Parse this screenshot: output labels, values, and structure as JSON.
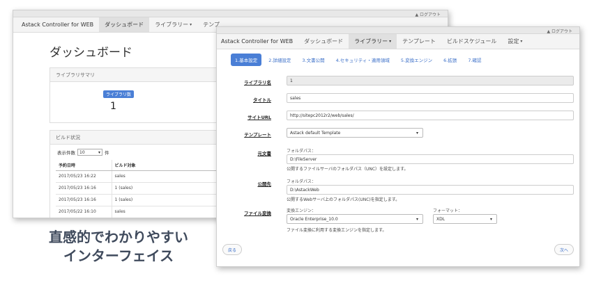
{
  "back_window": {
    "user": "▲ ログアウト",
    "nav": {
      "brand": "Astack Controller for WEB",
      "dashboard": "ダッシュボード",
      "library": "ライブラリー",
      "template": "テンプ"
    },
    "page_title": "ダッシュボード",
    "summary": {
      "header": "ライブラリサマリ",
      "badge": "ライブラリ数",
      "count": "1"
    },
    "build": {
      "header": "ビルド状況",
      "show_label": "表示件数",
      "show_value": "10",
      "show_suffix": "件",
      "columns": [
        "予約日時",
        "ビルド対象"
      ],
      "rows": [
        [
          "2017/05/23 16:22",
          "sales"
        ],
        [
          "2017/05/23 16:16",
          "1 (sales)"
        ],
        [
          "2017/05/23 16:16",
          "1 (sales)"
        ],
        [
          "2017/05/22 16:10",
          "sales"
        ]
      ]
    }
  },
  "front_window": {
    "user": "▲ ログアウト",
    "nav": {
      "brand": "Astack Controller for WEB",
      "dashboard": "ダッシュボード",
      "library": "ライブラリー",
      "template": "テンプレート",
      "schedule": "ビルドスケジュール",
      "settings": "設定"
    },
    "steps": [
      "1.基本設定",
      "2.詳細設定",
      "3.文書公開",
      "4.セキュリティ・適用領域",
      "5.変換エンジン",
      "6.拡張",
      "7.確認"
    ],
    "form": {
      "library_id_label": "ライブラリ名",
      "library_id_value": "1",
      "title_label": "タイトル",
      "title_value": "sales",
      "site_url_label": "サイトURL",
      "site_url_value": "http://sitepc2012r2/web/sales/",
      "template_label": "テンプレート",
      "template_value": "Astack default Template",
      "source_label": "元文書",
      "source_sublabel": "フォルダパス：",
      "source_value": "D:\\FileServer",
      "source_help": "公開するファイルサーバのフォルダパス（UNC）を設定します。",
      "publish_label": "公開先",
      "publish_sublabel": "フォルダパス：",
      "publish_value": "D:\\AstackWeb",
      "publish_help": "公開するWebサーバ上のフォルダパス(UNC)を指定します。",
      "convert_label": "ファイル変換",
      "engine_sublabel": "変換エンジン：",
      "engine_value": "Oracle Enterprise_10.0",
      "engine_help": "ファイル変換に利用する変換エンジンを指定します。",
      "format_sublabel": "フォーマット：",
      "format_value": "XDL"
    },
    "buttons": {
      "back": "戻る",
      "next": "次へ"
    }
  },
  "caption": {
    "line1": "直感的でわかりやすい",
    "line2": "インターフェイス"
  }
}
